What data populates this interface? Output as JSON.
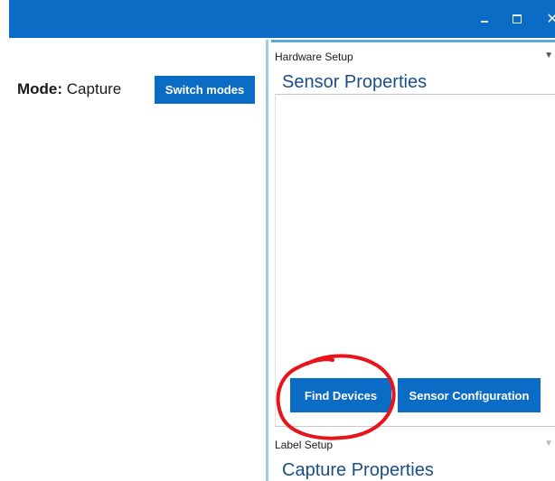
{
  "window": {
    "minimize_icon": "minimize-icon",
    "maximize_icon": "maximize-icon",
    "close_icon": "close-icon",
    "close_glyph": "✕",
    "accent": "#0b6cc5"
  },
  "mode": {
    "label": "Mode:",
    "value": "Capture",
    "switch_button": "Switch modes"
  },
  "hardware_setup": {
    "header": "Hardware Setup",
    "collapse_glyph": "▼",
    "title": "Sensor Properties",
    "find_devices_button": "Find Devices",
    "sensor_configuration_button": "Sensor Configuration"
  },
  "label_setup": {
    "header": "Label Setup",
    "collapse_glyph": "▼",
    "title": "Capture Properties"
  },
  "annotation": {
    "color": "#e8141b"
  }
}
